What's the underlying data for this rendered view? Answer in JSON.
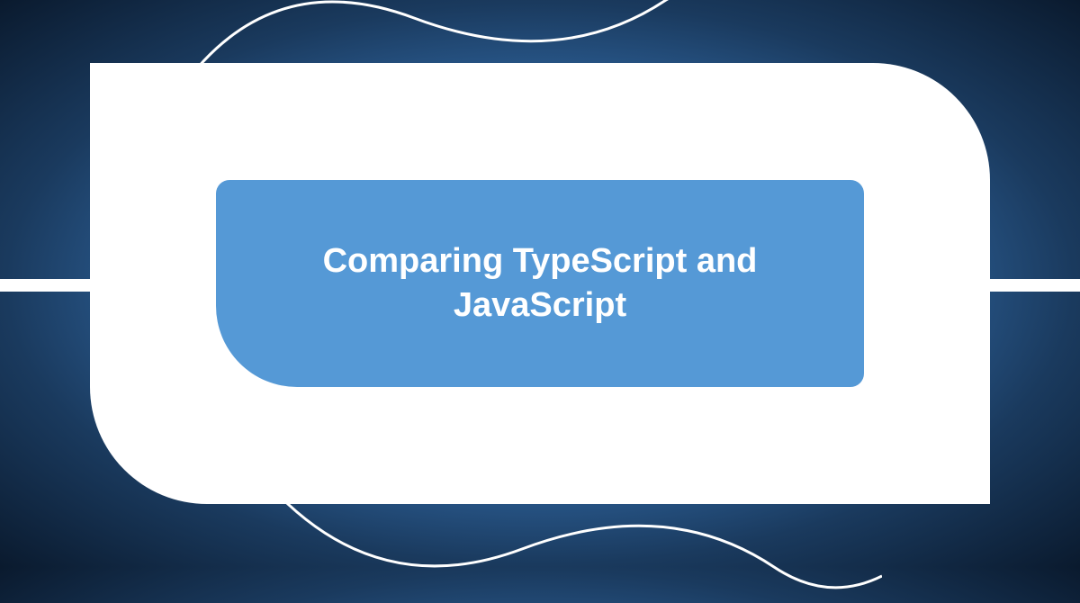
{
  "title": "Comparing TypeScript and JavaScript"
}
